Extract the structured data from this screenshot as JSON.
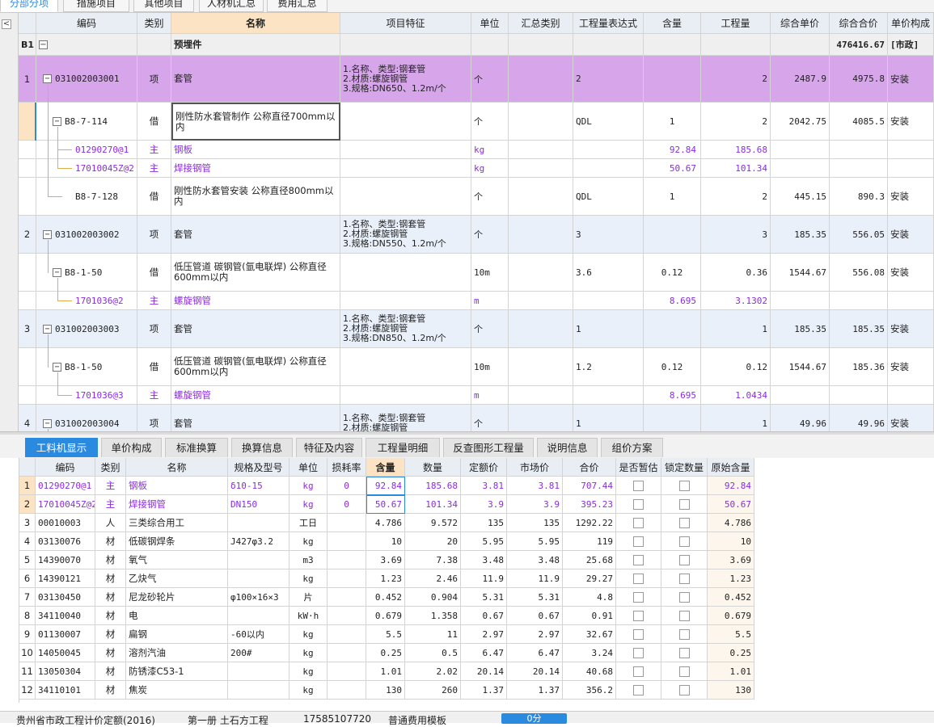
{
  "top_tabs": [
    "分部分项",
    "措施项目",
    "其他项目",
    "人材机汇总",
    "费用汇总"
  ],
  "collapse_symbol": "<",
  "upper_headers": [
    "编码",
    "类别",
    "名称",
    "项目特征",
    "单位",
    "汇总类别",
    "工程量表达式",
    "含量",
    "工程量",
    "综合单价",
    "综合合价",
    "单价构成"
  ],
  "section": {
    "id": "B1",
    "name": "预埋件",
    "total": "476416.67",
    "comp": "[市政]"
  },
  "upper_rows": [
    {
      "no": "1",
      "code": "031002003001",
      "type": "项",
      "name": "套管",
      "feature": "1.名称、类型:钢套管\n2.材质:螺旋钢管\n3.规格:DN650、1.2m/个",
      "unit": "个",
      "sumcat": "",
      "expr": "2",
      "content": "",
      "qty": "2",
      "price": "2487.9",
      "total": "4975.8",
      "comp": "安装"
    },
    {
      "no": "",
      "code": "B8-7-114",
      "type": "借",
      "name": "刚性防水套管制作 公称直径700mm以内",
      "feature": "",
      "unit": "个",
      "sumcat": "",
      "expr": "QDL",
      "content": "1",
      "qty": "2",
      "price": "2042.75",
      "total": "4085.5",
      "comp": "安装"
    },
    {
      "no": "",
      "code": "01290270@1",
      "type": "主",
      "name": "钢板",
      "feature": "",
      "unit": "kg",
      "sumcat": "",
      "expr": "",
      "content": "92.84",
      "qty": "185.68",
      "price": "",
      "total": "",
      "comp": ""
    },
    {
      "no": "",
      "code": "17010045Z@2",
      "type": "主",
      "name": "焊接钢管",
      "feature": "",
      "unit": "kg",
      "sumcat": "",
      "expr": "",
      "content": "50.67",
      "qty": "101.34",
      "price": "",
      "total": "",
      "comp": ""
    },
    {
      "no": "",
      "code": "B8-7-128",
      "type": "借",
      "name": "刚性防水套管安装 公称直径800mm以内",
      "feature": "",
      "unit": "个",
      "sumcat": "",
      "expr": "QDL",
      "content": "1",
      "qty": "2",
      "price": "445.15",
      "total": "890.3",
      "comp": "安装"
    },
    {
      "no": "2",
      "code": "031002003002",
      "type": "项",
      "name": "套管",
      "feature": "1.名称、类型:钢套管\n2.材质:螺旋钢管\n3.规格:DN550、1.2m/个",
      "unit": "个",
      "sumcat": "",
      "expr": "3",
      "content": "",
      "qty": "3",
      "price": "185.35",
      "total": "556.05",
      "comp": "安装"
    },
    {
      "no": "",
      "code": "B8-1-50",
      "type": "借",
      "name": "低压管道 碳钢管(氩电联焊) 公称直径600mm以内",
      "feature": "",
      "unit": "10m",
      "sumcat": "",
      "expr": "3.6",
      "content": "0.12",
      "qty": "0.36",
      "price": "1544.67",
      "total": "556.08",
      "comp": "安装"
    },
    {
      "no": "",
      "code": "1701036@2",
      "type": "主",
      "name": "螺旋钢管",
      "feature": "",
      "unit": "m",
      "sumcat": "",
      "expr": "",
      "content": "8.695",
      "qty": "3.1302",
      "price": "",
      "total": "",
      "comp": ""
    },
    {
      "no": "3",
      "code": "031002003003",
      "type": "项",
      "name": "套管",
      "feature": "1.名称、类型:钢套管\n2.材质:螺旋钢管\n3.规格:DN850、1.2m/个",
      "unit": "个",
      "sumcat": "",
      "expr": "1",
      "content": "",
      "qty": "1",
      "price": "185.35",
      "total": "185.35",
      "comp": "安装"
    },
    {
      "no": "",
      "code": "B8-1-50",
      "type": "借",
      "name": "低压管道 碳钢管(氩电联焊) 公称直径600mm以内",
      "feature": "",
      "unit": "10m",
      "sumcat": "",
      "expr": "1.2",
      "content": "0.12",
      "qty": "0.12",
      "price": "1544.67",
      "total": "185.36",
      "comp": "安装"
    },
    {
      "no": "",
      "code": "1701036@3",
      "type": "主",
      "name": "螺旋钢管",
      "feature": "",
      "unit": "m",
      "sumcat": "",
      "expr": "",
      "content": "8.695",
      "qty": "1.0434",
      "price": "",
      "total": "",
      "comp": ""
    },
    {
      "no": "4",
      "code": "031002003004",
      "type": "项",
      "name": "套管",
      "feature": "1.名称、类型:钢套管\n2.材质:螺旋钢管",
      "unit": "个",
      "sumcat": "",
      "expr": "1",
      "content": "",
      "qty": "1",
      "price": "49.96",
      "total": "49.96",
      "comp": "安装"
    }
  ],
  "bottom_tabs": [
    "工料机显示",
    "单价构成",
    "标准换算",
    "换算信息",
    "特征及内容",
    "工程量明细",
    "反查图形工程量",
    "说明信息",
    "组价方案"
  ],
  "lower_headers": [
    "编码",
    "类别",
    "名称",
    "规格及型号",
    "单位",
    "损耗率",
    "含量",
    "数量",
    "定额价",
    "市场价",
    "合价",
    "是否暂估",
    "锁定数量",
    "原始含量"
  ],
  "lower_rows": [
    {
      "no": "1",
      "code": "01290270@1",
      "type": "主",
      "name": "钢板",
      "spec": "δ10-15",
      "unit": "kg",
      "loss": "0",
      "content": "92.84",
      "qty": "185.68",
      "base": "3.81",
      "market": "3.81",
      "total": "707.44",
      "orig": "92.84"
    },
    {
      "no": "2",
      "code": "17010045Z@2",
      "type": "主",
      "name": "焊接钢管",
      "spec": "DN150",
      "unit": "kg",
      "loss": "0",
      "content": "50.67",
      "qty": "101.34",
      "base": "3.9",
      "market": "3.9",
      "total": "395.23",
      "orig": "50.67"
    },
    {
      "no": "3",
      "code": "00010003",
      "type": "人",
      "name": "三类综合用工",
      "spec": "",
      "unit": "工日",
      "loss": "",
      "content": "4.786",
      "qty": "9.572",
      "base": "135",
      "market": "135",
      "total": "1292.22",
      "orig": "4.786"
    },
    {
      "no": "4",
      "code": "03130076",
      "type": "材",
      "name": "低碳钢焊条",
      "spec": "J427φ3.2",
      "unit": "kg",
      "loss": "",
      "content": "10",
      "qty": "20",
      "base": "5.95",
      "market": "5.95",
      "total": "119",
      "orig": "10"
    },
    {
      "no": "5",
      "code": "14390070",
      "type": "材",
      "name": "氧气",
      "spec": "",
      "unit": "m3",
      "loss": "",
      "content": "3.69",
      "qty": "7.38",
      "base": "3.48",
      "market": "3.48",
      "total": "25.68",
      "orig": "3.69"
    },
    {
      "no": "6",
      "code": "14390121",
      "type": "材",
      "name": "乙炔气",
      "spec": "",
      "unit": "kg",
      "loss": "",
      "content": "1.23",
      "qty": "2.46",
      "base": "11.9",
      "market": "11.9",
      "total": "29.27",
      "orig": "1.23"
    },
    {
      "no": "7",
      "code": "03130450",
      "type": "材",
      "name": "尼龙砂轮片",
      "spec": "φ100×16×3",
      "unit": "片",
      "loss": "",
      "content": "0.452",
      "qty": "0.904",
      "base": "5.31",
      "market": "5.31",
      "total": "4.8",
      "orig": "0.452"
    },
    {
      "no": "8",
      "code": "34110040",
      "type": "材",
      "name": "电",
      "spec": "",
      "unit": "kW·h",
      "loss": "",
      "content": "0.679",
      "qty": "1.358",
      "base": "0.67",
      "market": "0.67",
      "total": "0.91",
      "orig": "0.679"
    },
    {
      "no": "9",
      "code": "01130007",
      "type": "材",
      "name": "扁钢",
      "spec": "-60以内",
      "unit": "kg",
      "loss": "",
      "content": "5.5",
      "qty": "11",
      "base": "2.97",
      "market": "2.97",
      "total": "32.67",
      "orig": "5.5"
    },
    {
      "no": "10",
      "code": "14050045",
      "type": "材",
      "name": "溶剂汽油",
      "spec": "200#",
      "unit": "kg",
      "loss": "",
      "content": "0.25",
      "qty": "0.5",
      "base": "6.47",
      "market": "6.47",
      "total": "3.24",
      "orig": "0.25"
    },
    {
      "no": "11",
      "code": "13050304",
      "type": "材",
      "name": "防锈漆C53-1",
      "spec": "",
      "unit": "kg",
      "loss": "",
      "content": "1.01",
      "qty": "2.02",
      "base": "20.14",
      "market": "20.14",
      "total": "40.68",
      "orig": "1.01"
    },
    {
      "no": "12",
      "code": "34110101",
      "type": "材",
      "name": "焦炭",
      "spec": "",
      "unit": "kg",
      "loss": "",
      "content": "130",
      "qty": "260",
      "base": "1.37",
      "market": "1.37",
      "total": "356.2",
      "orig": "130"
    }
  ],
  "status": {
    "norm": "贵州省市政工程计价定额(2016)",
    "book": "第一册 土石方工程",
    "phone": "17585107720",
    "template": "普通费用模板",
    "button": "0分"
  },
  "colors": {
    "accent": "#2a8ae0",
    "purple_row": "#d7a6ea",
    "blue_row": "#e9f0fa",
    "material": "#8a2be2",
    "selected_header": "#fbe3c3"
  }
}
